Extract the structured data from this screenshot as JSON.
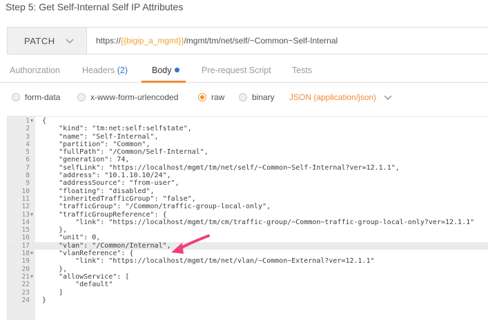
{
  "step": {
    "title": "Step 5: Get Self-Internal Self IP Attributes"
  },
  "request": {
    "method": "PATCH",
    "url_prefix": "https://",
    "url_var": "{{bigip_a_mgmt}}",
    "url_suffix": "/mgmt/tm/net/self/~Common~Self-Internal"
  },
  "tabs": {
    "authorization": "Authorization",
    "headers": "Headers",
    "headers_count": "(2)",
    "body": "Body",
    "prerequest": "Pre-request Script",
    "tests": "Tests"
  },
  "body_options": {
    "form_data": "form-data",
    "urlencoded": "x-www-form-urlencoded",
    "raw": "raw",
    "binary": "binary",
    "content_type": "JSON (application/json)"
  },
  "icons": {
    "method_dropdown": "chevron-down-icon",
    "type_dropdown": "chevron-down-icon",
    "fold": "triangle-down-icon",
    "annotation": "pink-arrow"
  },
  "colors": {
    "accent": "#f08a38",
    "blue": "#2a78c8",
    "arrow": "#f0407a"
  },
  "editor": {
    "lines": [
      {
        "n": "1",
        "fold": true,
        "text": "{"
      },
      {
        "n": "2",
        "fold": false,
        "text": "    \"kind\": \"tm:net:self:selfstate\","
      },
      {
        "n": "3",
        "fold": false,
        "text": "    \"name\": \"Self-Internal\","
      },
      {
        "n": "4",
        "fold": false,
        "text": "    \"partition\": \"Common\","
      },
      {
        "n": "5",
        "fold": false,
        "text": "    \"fullPath\": \"/Common/Self-Internal\","
      },
      {
        "n": "6",
        "fold": false,
        "text": "    \"generation\": 74,"
      },
      {
        "n": "7",
        "fold": false,
        "text": "    \"selfLink\": \"https://localhost/mgmt/tm/net/self/~Common~Self-Internal?ver=12.1.1\","
      },
      {
        "n": "8",
        "fold": false,
        "text": "    \"address\": \"10.1.10.10/24\","
      },
      {
        "n": "9",
        "fold": false,
        "text": "    \"addressSource\": \"from-user\","
      },
      {
        "n": "10",
        "fold": false,
        "text": "    \"floating\": \"disabled\","
      },
      {
        "n": "11",
        "fold": false,
        "text": "    \"inheritedTrafficGroup\": \"false\","
      },
      {
        "n": "12",
        "fold": false,
        "text": "    \"trafficGroup\": \"/Common/traffic-group-local-only\","
      },
      {
        "n": "13",
        "fold": true,
        "text": "    \"trafficGroupReference\": {"
      },
      {
        "n": "14",
        "fold": false,
        "text": "        \"link\": \"https://localhost/mgmt/tm/cm/traffic-group/~Common~traffic-group-local-only?ver=12.1.1\""
      },
      {
        "n": "15",
        "fold": false,
        "text": "    },"
      },
      {
        "n": "16",
        "fold": false,
        "text": "    \"unit\": 0,"
      },
      {
        "n": "17",
        "fold": false,
        "text": "    \"vlan\": \"/Common/Internal\","
      },
      {
        "n": "18",
        "fold": true,
        "text": "    \"vlanReference\": {"
      },
      {
        "n": "19",
        "fold": false,
        "text": "        \"link\": \"https://localhost/mgmt/tm/net/vlan/~Common~External?ver=12.1.1\""
      },
      {
        "n": "20",
        "fold": false,
        "text": "    },"
      },
      {
        "n": "21",
        "fold": true,
        "text": "    \"allowService\": ["
      },
      {
        "n": "22",
        "fold": false,
        "text": "        \"default\""
      },
      {
        "n": "23",
        "fold": false,
        "text": "    ]"
      },
      {
        "n": "24",
        "fold": false,
        "text": "}"
      }
    ]
  }
}
